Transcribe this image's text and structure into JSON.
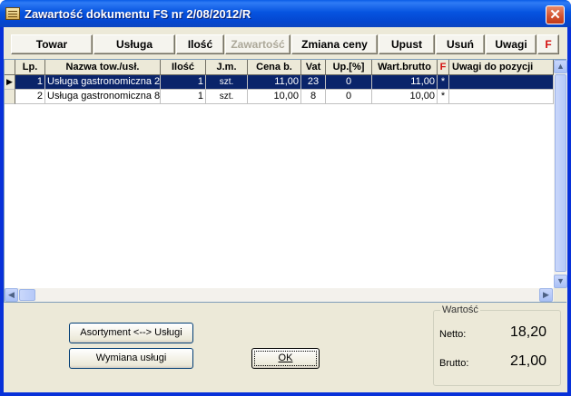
{
  "window": {
    "title": "Zawartość dokumentu FS nr 2/08/2012/R",
    "close_glyph": "✕"
  },
  "toolbar": {
    "buttons": [
      {
        "label": "Towar",
        "enabled": true
      },
      {
        "label": "Usługa",
        "enabled": true
      },
      {
        "label": "Ilość",
        "enabled": true
      },
      {
        "label": "Zawartość",
        "enabled": false
      },
      {
        "label": "Zmiana ceny",
        "enabled": true
      },
      {
        "label": "Upust",
        "enabled": true
      },
      {
        "label": "Usuń",
        "enabled": true
      },
      {
        "label": "Uwagi",
        "enabled": true
      },
      {
        "label": "F",
        "enabled": true
      }
    ]
  },
  "grid": {
    "columns": [
      "Lp.",
      "Nazwa tow./usł.",
      "Ilość",
      "J.m.",
      "Cena b.",
      "Vat",
      "Up.[%]",
      "Wart.brutto",
      "F",
      "Uwagi do pozycji"
    ],
    "rows": [
      {
        "lp": "1",
        "name": "Usługa gastronomiczna 2",
        "qty": "1",
        "unit": "szt.",
        "price": "11,00",
        "vat": "23",
        "discount": "0",
        "gross": "11,00",
        "flag": "*",
        "notes": "",
        "selected": true
      },
      {
        "lp": "2",
        "name": "Usługa gastronomiczna 8",
        "qty": "1",
        "unit": "szt.",
        "price": "10,00",
        "vat": "8",
        "discount": "0",
        "gross": "10,00",
        "flag": "*",
        "notes": "",
        "selected": false
      }
    ],
    "row_indicator": "▶"
  },
  "buttons": {
    "assortment": "Asortyment <--> Usługi",
    "swap_service": "Wymiana usługi",
    "ok": "OK"
  },
  "summary": {
    "title": "Wartość",
    "net_label": "Netto:",
    "net_value": "18,20",
    "gross_label": "Brutto:",
    "gross_value": "21,00"
  },
  "colors": {
    "titlebar": "#0654e0",
    "selection": "#0a246a",
    "accent_red": "#d41010",
    "face": "#ece9d8"
  }
}
